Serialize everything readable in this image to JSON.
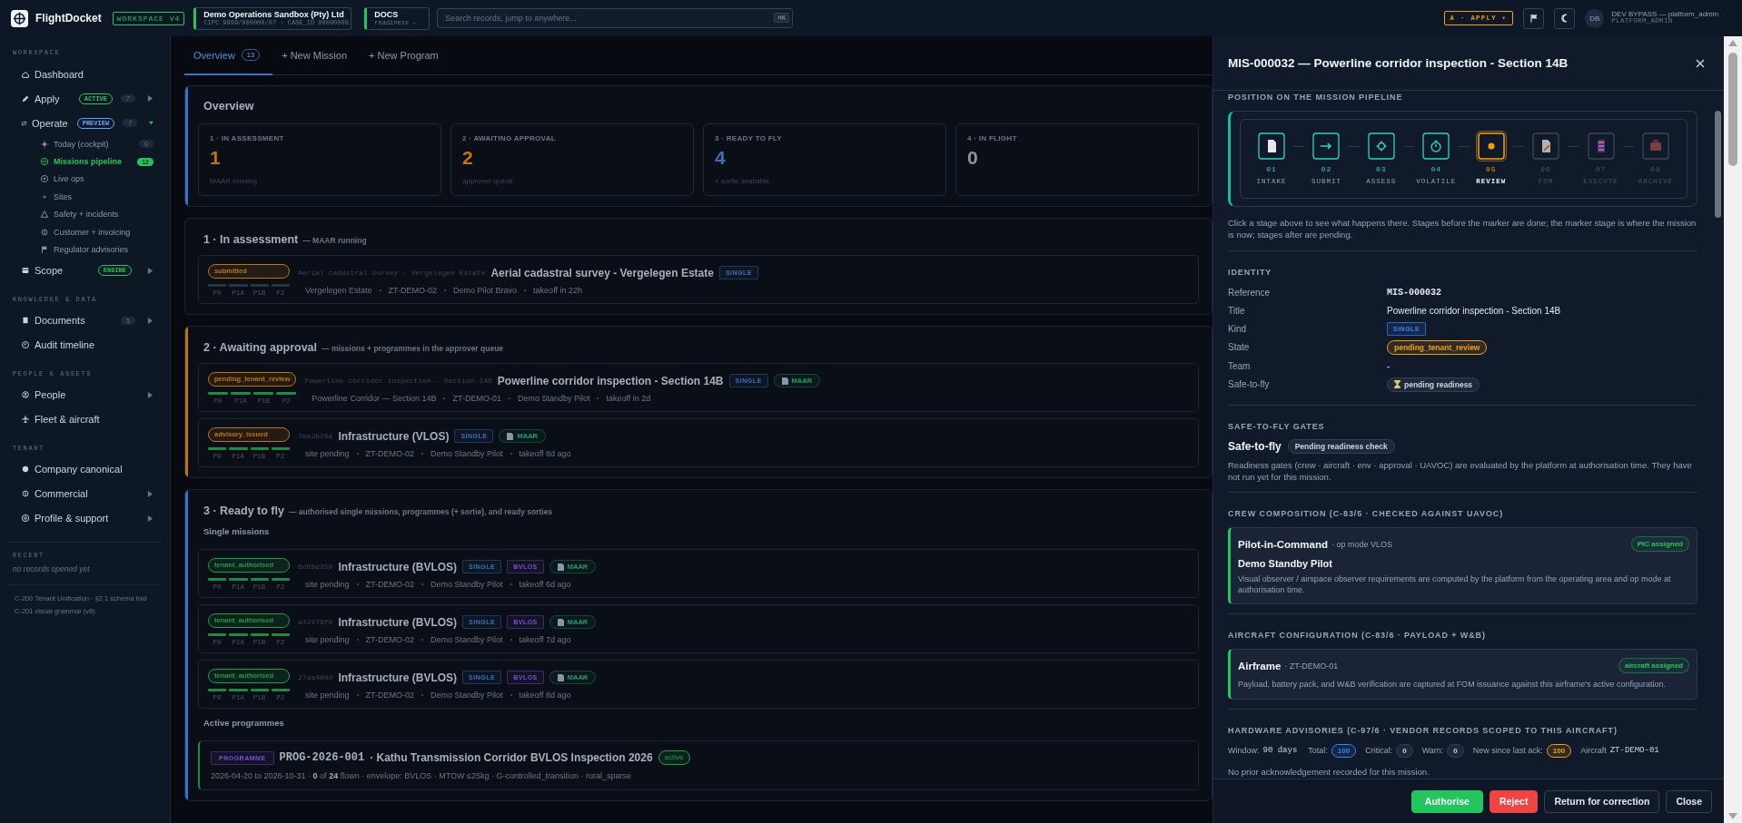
{
  "topbar": {
    "app_name": "FlightDocket",
    "workspace_badge": "WORKSPACE V4",
    "org": {
      "name": "Demo Operations Sandbox (Pty) Ltd",
      "detail": "CIPC 9999/000000/07 · CASE_ID 00000000…"
    },
    "docs": {
      "label": "DOCS",
      "detail": "readiness –"
    },
    "search": {
      "placeholder": "Search records, jump to anywhere...",
      "shortcut": "⌘K"
    },
    "mode_button": "A · APPLY ▾",
    "user": {
      "initials": "DB",
      "name": "DEV BYPASS — platform_admin",
      "role": "PLATFORM_ADMIN"
    }
  },
  "sidebar": {
    "sections": [
      {
        "heading": "WORKSPACE",
        "items": [
          {
            "label": "Dashboard",
            "selected": false
          },
          {
            "label": "Apply",
            "selected": false,
            "badge": {
              "text": "ACTIVE",
              "color": "#22c55e"
            },
            "count": "7",
            "expanded": false
          },
          {
            "label": "Operate",
            "selected": false,
            "badge": {
              "text": "PREVIEW",
              "color": "#60a5fa"
            },
            "count": "7",
            "expanded": true,
            "children": [
              {
                "label": "Today (cockpit)",
                "selected": false,
                "count": "0"
              },
              {
                "label": "Missions pipeline",
                "selected": true,
                "count": "12"
              },
              {
                "label": "Live ops",
                "selected": false
              },
              {
                "label": "Sites",
                "selected": false
              },
              {
                "label": "Safety + incidents",
                "selected": false
              },
              {
                "label": "Customer + invoicing",
                "selected": false
              },
              {
                "label": "Regulator advisories",
                "selected": false
              }
            ]
          },
          {
            "label": "Scope",
            "selected": false,
            "badge": {
              "text": "ENGINE",
              "color": "#22c55e"
            },
            "expanded": false
          }
        ]
      },
      {
        "heading": "KNOWLEDGE & DATA",
        "items": [
          {
            "label": "Documents",
            "selected": false,
            "count": "5",
            "expanded": false
          },
          {
            "label": "Audit timeline",
            "selected": false
          }
        ]
      },
      {
        "heading": "PEOPLE & ASSETS",
        "items": [
          {
            "label": "People",
            "selected": false,
            "expanded": false
          },
          {
            "label": "Fleet & aircraft",
            "selected": false
          }
        ]
      },
      {
        "heading": "TENANT",
        "items": [
          {
            "label": "Company canonical",
            "selected": false
          },
          {
            "label": "Commercial",
            "selected": false,
            "expanded": false
          },
          {
            "label": "Profile & support",
            "selected": false,
            "expanded": false
          }
        ]
      }
    ],
    "recent": {
      "heading": "RECENT",
      "empty_text": "no records opened yet"
    },
    "footer_notes": [
      "C-200 Tenant Unification · §2.1 schema fold",
      "C-201 visual grammar (v8)"
    ]
  },
  "main": {
    "tabs": [
      {
        "label": "Overview",
        "count": "13",
        "selected": true
      },
      {
        "label": "+ New Mission",
        "selected": false
      },
      {
        "label": "+ New Program",
        "selected": false
      }
    ],
    "overview": {
      "title": "Overview",
      "color": "#3b6fd0",
      "stats": [
        {
          "label": "1 · IN ASSESSMENT",
          "value": "1",
          "caption": "MAAR running",
          "color": "#c2740c"
        },
        {
          "label": "2 · AWAITING APPROVAL",
          "value": "2",
          "caption": "approver queue",
          "color": "#c2740c"
        },
        {
          "label": "3 · READY TO FLY",
          "value": "4",
          "caption": "+ sortie available",
          "color": "#3f6fb5"
        },
        {
          "label": "4 · IN FLIGHT",
          "value": "0",
          "color": "#8b95a3"
        }
      ]
    },
    "sections": [
      {
        "title": "1 · In assessment",
        "subtitle": "— MAAR running",
        "groups": [
          {
            "items": [
              {
                "kind": "mission",
                "status": {
                  "text": "submitted",
                  "color": "#c2740c"
                },
                "gates": [
                  {
                    "label": "P0",
                    "done": false
                  },
                  {
                    "label": "P1A",
                    "done": false
                  },
                  {
                    "label": "P1B",
                    "done": false
                  },
                  {
                    "label": "P2",
                    "done": false
                  }
                ],
                "ref": "Aerial cadastral survey - Vergelegen Estate",
                "title": "Aerial cadastral survey - Vergelegen Estate",
                "tags": [
                  {
                    "kind": "tag",
                    "text": "SINGLE",
                    "color": "#3f6fb5"
                  }
                ],
                "meta": [
                  "Vergelegen Estate",
                  "ZT-DEMO-02",
                  "Demo Pilot Bravo",
                  "takeoff in 22h"
                ]
              }
            ]
          }
        ]
      },
      {
        "title": "2 · Awaiting approval",
        "subtitle": "— missions + programmes in the approver queue",
        "color": "#c2740c",
        "groups": [
          {
            "items": [
              {
                "kind": "mission",
                "status": {
                  "text": "pending_tenant_review",
                  "color": "#c2740c"
                },
                "gates": [
                  {
                    "label": "P0",
                    "done": true
                  },
                  {
                    "label": "P1A",
                    "done": true
                  },
                  {
                    "label": "P1B",
                    "done": true
                  },
                  {
                    "label": "P2",
                    "done": true
                  }
                ],
                "ref": "Powerline corridor inspection - Section 14B",
                "title": "Powerline corridor inspection - Section 14B",
                "tags": [
                  {
                    "kind": "tag",
                    "text": "SINGLE",
                    "color": "#3f6fb5"
                  },
                  {
                    "kind": "document",
                    "text": "MAAR",
                    "color": "#1f9d6b"
                  }
                ],
                "meta": [
                  "Powerline Corridor — Section 14B",
                  "ZT-DEMO-01",
                  "Demo Standby Pilot",
                  "takeoff in 2d"
                ]
              },
              {
                "kind": "mission",
                "status": {
                  "text": "advisory_issued",
                  "color": "#c2740c"
                },
                "gates": [
                  {
                    "label": "P0",
                    "done": true
                  },
                  {
                    "label": "P1A",
                    "done": true
                  },
                  {
                    "label": "P1B",
                    "done": true
                  },
                  {
                    "label": "P2",
                    "done": true
                  }
                ],
                "ref": "7ea2b26a",
                "title": "Infrastructure (VLOS)",
                "tags": [
                  {
                    "kind": "tag",
                    "text": "SINGLE",
                    "color": "#3f6fb5"
                  },
                  {
                    "kind": "document",
                    "text": "MAAR",
                    "color": "#1f9d6b"
                  }
                ],
                "meta": [
                  "site pending",
                  "ZT-DEMO-02",
                  "Demo Standby Pilot",
                  "takeoff 8d ago"
                ]
              }
            ]
          }
        ]
      },
      {
        "title": "3 · Ready to fly",
        "subtitle": "— authorised single missions, programmes (+ sortie), and ready sorties",
        "color": "#3b6fd0",
        "groups": [
          {
            "heading": "Single missions",
            "items": [
              {
                "kind": "mission",
                "status": {
                  "text": "tenant_authorised",
                  "color": "#1f9d48"
                },
                "gates": [
                  {
                    "label": "P0",
                    "done": true
                  },
                  {
                    "label": "P1A",
                    "done": true
                  },
                  {
                    "label": "P1B",
                    "done": true
                  },
                  {
                    "label": "P2",
                    "done": true
                  }
                ],
                "ref": "6d68e359",
                "title": "Infrastructure (BVLOS)",
                "tags": [
                  {
                    "kind": "tag",
                    "text": "SINGLE",
                    "color": "#3f6fb5"
                  },
                  {
                    "kind": "tag",
                    "text": "BVLOS",
                    "color": "#7c4dd6"
                  },
                  {
                    "kind": "document",
                    "text": "MAAR",
                    "color": "#1f9d6b"
                  }
                ],
                "meta": [
                  "site pending",
                  "ZT-DEMO-02",
                  "Demo Standby Pilot",
                  "takeoff 6d ago"
                ]
              },
              {
                "kind": "mission",
                "status": {
                  "text": "tenant_authorised",
                  "color": "#1f9d48"
                },
                "gates": [
                  {
                    "label": "P0",
                    "done": true
                  },
                  {
                    "label": "P1A",
                    "done": true
                  },
                  {
                    "label": "P1B",
                    "done": true
                  },
                  {
                    "label": "P2",
                    "done": true
                  }
                ],
                "ref": "a42476f6",
                "title": "Infrastructure (BVLOS)",
                "tags": [
                  {
                    "kind": "tag",
                    "text": "SINGLE",
                    "color": "#3f6fb5"
                  },
                  {
                    "kind": "tag",
                    "text": "BVLOS",
                    "color": "#7c4dd6"
                  },
                  {
                    "kind": "document",
                    "text": "MAAR",
                    "color": "#1f9d6b"
                  }
                ],
                "meta": [
                  "site pending",
                  "ZT-DEMO-02",
                  "Demo Standby Pilot",
                  "takeoff 7d ago"
                ]
              },
              {
                "kind": "mission",
                "status": {
                  "text": "tenant_authorised",
                  "color": "#1f9d48"
                },
                "gates": [
                  {
                    "label": "P0",
                    "done": true
                  },
                  {
                    "label": "P1A",
                    "done": true
                  },
                  {
                    "label": "P1B",
                    "done": true
                  },
                  {
                    "label": "P2",
                    "done": true
                  }
                ],
                "ref": "27aa400d",
                "title": "Infrastructure (BVLOS)",
                "tags": [
                  {
                    "kind": "tag",
                    "text": "SINGLE",
                    "color": "#3f6fb5"
                  },
                  {
                    "kind": "tag",
                    "text": "BVLOS",
                    "color": "#7c4dd6"
                  },
                  {
                    "kind": "document",
                    "text": "MAAR",
                    "color": "#1f9d6b"
                  }
                ],
                "meta": [
                  "site pending",
                  "ZT-DEMO-02",
                  "Demo Standby Pilot",
                  "takeoff 8d ago"
                ]
              }
            ]
          },
          {
            "heading": "Active programmes",
            "items": [
              {
                "kind": "programme",
                "tag": {
                  "text": "PROGRAMME",
                  "color": "#7c4dd6"
                },
                "code": "PROG-2026-001",
                "title": "· Kathu Transmission Corridor BVLOS Inspection 2026",
                "status": {
                  "text": "active",
                  "color": "#1f9d48"
                },
                "summary": "2026-04-20 to 2026-10-31 · **0** of **24** flown · envelope: BVLOS · MTOW ≤25kg · G-controlled_transition · rural_sparse"
              }
            ]
          }
        ]
      }
    ]
  },
  "detail_panel": {
    "title": "MIS-000032 — Powerline corridor inspection - Section 14B",
    "pipeline": {
      "heading": "POSITION ON THE MISSION PIPELINE",
      "stages": [
        {
          "number": "01",
          "label": "INTAKE",
          "done": true,
          "current": false
        },
        {
          "number": "02",
          "label": "SUBMIT",
          "done": true,
          "current": false
        },
        {
          "number": "03",
          "label": "ASSESS",
          "done": true,
          "current": false
        },
        {
          "number": "04",
          "label": "VOLATILE",
          "done": true,
          "current": false
        },
        {
          "number": "05",
          "label": "REVIEW",
          "done": false,
          "current": true
        },
        {
          "number": "06",
          "label": "FOM",
          "done": false,
          "current": false
        },
        {
          "number": "07",
          "label": "EXECUTE",
          "done": false,
          "current": false
        },
        {
          "number": "08",
          "label": "ARCHIVE",
          "done": false,
          "current": false
        }
      ],
      "note": "Click a stage above to see what happens there. Stages before the marker are done; the marker stage is where the mission is now; stages after are pending."
    },
    "identity": {
      "heading": "IDENTITY",
      "fields": [
        {
          "label": "Reference",
          "kind": "code",
          "value": "MIS-000032"
        },
        {
          "label": "Title",
          "kind": "text",
          "value": "Powerline corridor inspection - Section 14B"
        },
        {
          "label": "Kind",
          "kind": "tag",
          "value": "SINGLE",
          "color": "#3b82f6"
        },
        {
          "label": "State",
          "kind": "pill",
          "value": "pending_tenant_review",
          "color": "#f59e0b"
        },
        {
          "label": "Team",
          "kind": "text",
          "value": "-"
        },
        {
          "label": "Safe-to-fly",
          "kind": "pending",
          "value": "pending readiness"
        }
      ]
    },
    "gates": {
      "heading": "SAFE-TO-FLY GATES",
      "title": "Safe-to-fly",
      "status": "Pending readiness check",
      "note": "Readiness gates (crew · aircraft · env · approval · UAVOC) are evaluated by the platform at authorisation time. They have not run yet for this mission."
    },
    "crew": {
      "heading": "CREW COMPOSITION (C-83/5 · CHECKED AGAINST UAVOC)",
      "role": "Pilot-in-Command",
      "detail": "· op mode VLOS",
      "badge": "PIC assigned",
      "person": "Demo Standby Pilot",
      "note": "Visual observer / airspace observer requirements are computed by the platform from the operating area and op mode at authorisation time."
    },
    "aircraft": {
      "heading": "AIRCRAFT CONFIGURATION (C-83/6 · PAYLOAD + W&B)",
      "title": "Airframe",
      "detail": "· ZT-DEMO-01",
      "badge": "aircraft assigned",
      "note": "Payload, battery pack, and W&B verification are captured at FOM issuance against this airframe's active configuration."
    },
    "advisories": {
      "heading": "HARDWARE ADVISORIES (C-97/6 · VENDOR RECORDS SCOPED TO THIS AIRCRAFT)",
      "window": {
        "label": "Window:",
        "value": "90 days"
      },
      "counts": [
        {
          "label": "Total:",
          "value": "100",
          "color": "#3b82f6"
        },
        {
          "label": "Critical:",
          "value": "0"
        },
        {
          "label": "Warn:",
          "value": "0"
        },
        {
          "label": "New since last ack:",
          "value": "100",
          "color": "#f59e0b"
        }
      ],
      "aircraft": {
        "label": "Aircraft",
        "value": "ZT-DEMO-01"
      },
      "note": "No prior acknowledgement recorded for this mission."
    },
    "actions": [
      {
        "label": "Authorise",
        "kind": "approve"
      },
      {
        "label": "Reject",
        "kind": "danger"
      },
      {
        "label": "Return for correction",
        "kind": "secondary"
      },
      {
        "label": "Close",
        "kind": "secondary"
      }
    ]
  }
}
